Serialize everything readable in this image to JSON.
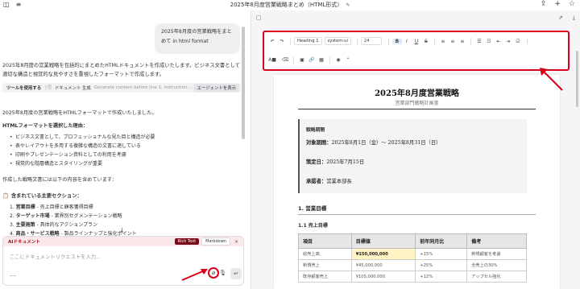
{
  "window": {
    "title": "2025年8月度営業戦略まとめ（HTML形式）",
    "colors": {
      "accent_red": "#d7001d",
      "doc_badge": "#a01020",
      "active_mode": "#7a0c19"
    }
  },
  "chat": {
    "user_message": "2025年8月度の営業戦略をまとめて in html format",
    "reply_intro": "2025年8月度の営業戦略を包括的にまとめたHTMLドキュメントを作成いたします。ビジネス文書として適切な構造と視覚的な見やすさを重視したフォーマットで作成します。",
    "tool": {
      "label": "ツールを使用する",
      "name": "ドキュメント 生成",
      "args": "Generate content before line 1, instruction: ...",
      "show_button": "エージェントを表示"
    },
    "created_text": "2025年8月度の営業戦略をHTMLフォーマットで作成いたしました。",
    "reasons_heading": "HTMLフォーマットを選択した理由：",
    "reasons": [
      "ビジネス文書として、プロフェッショナルな見た目と構造が必要",
      "表やレイアウトを多用する複雑な構造の文書に適している",
      "印刷やプレゼンテーション資料としての利用を考慮",
      "視覚的な階層構造とスタイリングが重要"
    ],
    "contents_intro": "作成した戦略文書には以下の内容を含めています：",
    "contents_heading": "含まれている主要セクション：",
    "contents": [
      {
        "bold": "営業目標",
        "rest": " - 売上目標と顧客獲得目標"
      },
      {
        "bold": "ターゲット市場",
        "rest": " - 業界別セグメンテーション戦略"
      },
      {
        "bold": "主要施策",
        "rest": " - 具体的なアクションプラン"
      },
      {
        "bold": "商品・サービス戦略",
        "rest": " - 製品ラインナップと強化ポイント"
      }
    ]
  },
  "input": {
    "badge": "AIドキュメント",
    "mode_rich": "Rich Text",
    "mode_markdown": "Markdown",
    "placeholder": "ここにドキュメントリクエストを入力...",
    "more_icon": "ellipsis-icon",
    "attach_icon": "paperclip-icon",
    "mic_icon": "mic-icon",
    "send_icon": "send-icon"
  },
  "toolbar": {
    "block_style": "Heading 1",
    "font_family": "system-ui",
    "font_size": "24"
  },
  "document": {
    "title": "2025年8月度営業戦略",
    "subtitle": "営業部門戦略計画書",
    "info_heading": "戦略期間",
    "period_label": "対象期間：",
    "period_value": "2025年8月1日（金）〜 2025年8月31日（日）",
    "created_label": "策定日：",
    "created_value": "2025年7月15日",
    "approver_label": "承認者：",
    "approver_value": "営業本部長",
    "section1": "1. 営業目標",
    "section11": "1.1 売上目標",
    "table": {
      "headers": [
        "項目",
        "目標値",
        "前年同月比",
        "備考"
      ],
      "rows": [
        [
          "総売上高",
          "¥150,000,000",
          "+15%",
          "新規顧客を考慮"
        ],
        [
          "新規売上",
          "¥45,000,000",
          "+25%",
          "全売上の30%"
        ],
        [
          "既存顧客売上",
          "¥105,000,000",
          "+12%",
          "アップセル強化"
        ]
      ]
    }
  }
}
